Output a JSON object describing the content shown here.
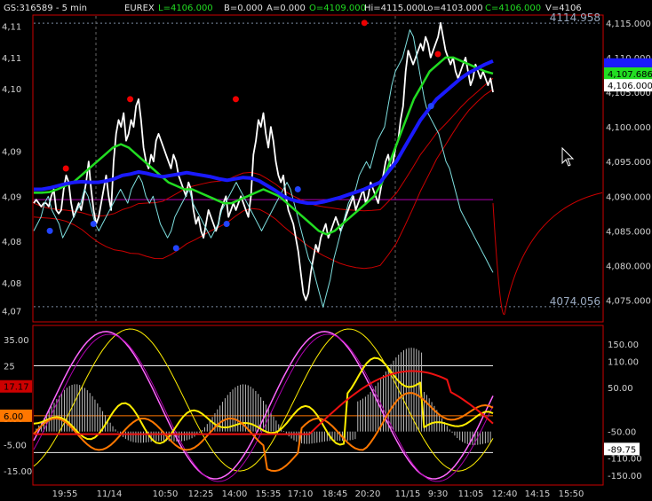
{
  "header": {
    "symbol": "GS:316589 - 5 min",
    "exchange": "EUREX",
    "last": "L=4106.000",
    "bid": "B=0.000",
    "ask": "A=0.000",
    "open": "O=4109.000",
    "high": "Hi=4115.000",
    "low": "Lo=4103.000",
    "close": "C=4106.000",
    "volume": "V=4106"
  },
  "colors": {
    "bg": "#000000",
    "price": "#ffffff",
    "cyan": "#7fe0e0",
    "green": "#22dd22",
    "blue": "#1a1aff",
    "red": "#cc0000",
    "magenta": "#b000b0",
    "yellow": "#ffee00",
    "orange": "#ff7700",
    "pink": "#ff66ff",
    "dot_red": "#ee0000",
    "dot_blue": "#2244ff",
    "gray_hist": "#bbbbbb"
  },
  "chart_data": [
    {
      "type": "line",
      "panel": "price",
      "title": "GS:316589 - 5 min",
      "ylim": [
        4072,
        4116
      ],
      "left_ticks": [
        "4,11",
        "4,11",
        "4,10",
        "4,09",
        "4,09",
        "4,08",
        "4,08",
        "4,07"
      ],
      "left_tick_values": [
        4114.5,
        4110,
        4105.5,
        4096.5,
        4090,
        4083.5,
        4077.5,
        4073.5
      ],
      "right_ticks": [
        4115,
        4110,
        4105,
        4100,
        4095,
        4090,
        4085,
        4080,
        4075
      ],
      "right_tick_labels": [
        "4,115.000",
        "4,110.000",
        "4,105.000",
        "4,100.000",
        "4,095.000",
        "4,090.000",
        "4,085.000",
        "4,080.000",
        "4,075.000"
      ],
      "upper_band_label": "4114.958",
      "upper_band_value": 4114.958,
      "lower_band_label": "4074.056",
      "lower_band_value": 4074.056,
      "horizontal_line": 4089.5,
      "price_badges": [
        {
          "label": "4,107.686",
          "value": 4107.686,
          "color": "#22dd22"
        },
        {
          "label": "4,106.000",
          "value": 4106.0,
          "color": "#ffffff"
        }
      ],
      "blue_badge_value": 4109.0,
      "x_ticks": [
        "19:55",
        "11/14",
        "10:50",
        "12:25",
        "14:00",
        "15:35",
        "17:10",
        "18:45",
        "20:20",
        "11/15",
        "9:30",
        "11:05",
        "12:40",
        "14:15",
        "15:50"
      ],
      "series": [
        {
          "role": "price",
          "color": "#ffffff",
          "values": [
            4089,
            4089.5,
            4089,
            4088.5,
            4089,
            4089,
            4088.5,
            4090,
            4091,
            4088,
            4087.5,
            4088,
            4091,
            4093,
            4092,
            4089,
            4087,
            4088,
            4089,
            4088,
            4090,
            4092,
            4095,
            4091,
            4088,
            4086,
            4087,
            4089,
            4091,
            4093,
            4090,
            4088,
            4095,
            4099,
            4101,
            4100,
            4102,
            4098,
            4099,
            4101,
            4100,
            4103,
            4104,
            4101,
            4097,
            4095,
            4094,
            4096,
            4095,
            4098,
            4099,
            4098,
            4097,
            4096,
            4095,
            4094,
            4096,
            4095,
            4093,
            4092,
            4091,
            4090,
            4092,
            4091,
            4088,
            4086,
            4087,
            4085,
            4084,
            4086,
            4088,
            4087,
            4086,
            4085,
            4086,
            4088,
            4089,
            4090,
            4087,
            4088,
            4089,
            4088,
            4089,
            4090,
            4089,
            4088,
            4087,
            4090,
            4096,
            4098,
            4101,
            4100,
            4102,
            4099,
            4097,
            4100,
            4098,
            4095,
            4093,
            4092,
            4093,
            4090,
            4088,
            4087,
            4086,
            4084,
            4082,
            4079,
            4076,
            4075,
            4076,
            4079,
            4081,
            4083,
            4082,
            4084,
            4085,
            4086,
            4084,
            4085,
            4086,
            4087,
            4086,
            4085,
            4086,
            4087,
            4088,
            4089,
            4090,
            4088,
            4089,
            4090,
            4091,
            4089,
            4090,
            4092,
            4091,
            4090,
            4089,
            4091,
            4093,
            4095,
            4096,
            4094,
            4095,
            4097,
            4098,
            4101,
            4103,
            4108,
            4111,
            4110,
            4109,
            4110,
            4111,
            4112,
            4111,
            4113,
            4112,
            4110,
            4111,
            4112,
            4113,
            4115,
            4113,
            4111,
            4110,
            4109,
            4110,
            4108,
            4107,
            4108,
            4109,
            4110,
            4108,
            4106,
            4107,
            4109,
            4108,
            4107,
            4108,
            4107,
            4106,
            4107,
            4105
          ]
        },
        {
          "role": "cyan-oscillator-overlay",
          "color": "#7fe0e0",
          "values": [
            4085,
            4086,
            4087,
            4089,
            4090,
            4088,
            4087,
            4086,
            4084,
            4085,
            4086,
            4087,
            4088,
            4089,
            4091,
            4090,
            4088,
            4086,
            4085,
            4086,
            4087,
            4088,
            4089,
            4090,
            4091,
            4090,
            4089,
            4091,
            4092,
            4093,
            4092,
            4090,
            4089,
            4090,
            4088,
            4086,
            4085,
            4084,
            4085,
            4087,
            4088,
            4089,
            4090,
            4091,
            4089,
            4088,
            4087,
            4086,
            4085,
            4084,
            4085,
            4086,
            4088,
            4089,
            4090,
            4091,
            4092,
            4091,
            4090,
            4089,
            4088,
            4087,
            4086,
            4085,
            4086,
            4087,
            4088,
            4089,
            4090,
            4091,
            4092,
            4091,
            4089,
            4087,
            4085,
            4083,
            4081,
            4080,
            4078,
            4076,
            4074,
            4076,
            4078,
            4081,
            4083,
            4085,
            4087,
            4089,
            4090,
            4091,
            4093,
            4094,
            4095,
            4094,
            4096,
            4098,
            4099,
            4100,
            4103,
            4106,
            4108,
            4109,
            4110,
            4112,
            4114,
            4113,
            4110,
            4107,
            4104,
            4102,
            4101,
            4100,
            4099,
            4097,
            4095,
            4094,
            4092,
            4090,
            4088,
            4087,
            4086,
            4085,
            4084,
            4083,
            4082,
            4081,
            4080,
            4079
          ]
        },
        {
          "role": "green-average",
          "color": "#22dd22",
          "values": [
            4090.5,
            4090.5,
            4090.6,
            4091,
            4091.5,
            4092,
            4093,
            4094,
            4095,
            4096,
            4097,
            4097.5,
            4097,
            4096,
            4095,
            4094,
            4093,
            4092,
            4091.5,
            4091,
            4091,
            4090.5,
            4090,
            4089.5,
            4089,
            4089,
            4089.5,
            4090,
            4090.5,
            4091,
            4090.5,
            4090,
            4089,
            4088,
            4087,
            4086,
            4085,
            4084.5,
            4085,
            4086,
            4087,
            4088,
            4089,
            4090,
            4092,
            4095,
            4098,
            4101,
            4104,
            4106,
            4108,
            4109,
            4110,
            4110,
            4109.5,
            4109,
            4108.5,
            4108,
            4107.7
          ]
        },
        {
          "role": "blue-average",
          "color": "#1a1aff",
          "values": [
            4091,
            4091,
            4091.2,
            4091.5,
            4091.8,
            4092,
            4092.1,
            4092,
            4092,
            4092.2,
            4092.5,
            4093,
            4093.2,
            4093.5,
            4093.3,
            4093,
            4092.8,
            4093,
            4093.2,
            4093.4,
            4093.2,
            4093,
            4092.8,
            4092.5,
            4092.3,
            4092.5,
            4092.7,
            4092.6,
            4092.2,
            4091.5,
            4090.8,
            4090,
            4089.5,
            4089.2,
            4089,
            4089,
            4089.2,
            4089.5,
            4089.8,
            4090.2,
            4090.6,
            4091,
            4091.5,
            4092,
            4093.5,
            4095,
            4097,
            4099,
            4101,
            4102.5,
            4104,
            4105,
            4106,
            4107,
            4107.8,
            4108.4,
            4109,
            4109.5
          ]
        }
      ],
      "dots": [
        {
          "i": 0.07,
          "v": 4094,
          "color": "#ee0000"
        },
        {
          "i": 0.21,
          "v": 4104,
          "color": "#ee0000"
        },
        {
          "i": 0.44,
          "v": 4104,
          "color": "#ee0000"
        },
        {
          "i": 0.72,
          "v": 4115,
          "color": "#ee0000"
        },
        {
          "i": 0.88,
          "v": 4110.5,
          "color": "#ee0000"
        },
        {
          "i": 0.035,
          "v": 4085,
          "color": "#2244ff"
        },
        {
          "i": 0.13,
          "v": 4086,
          "color": "#2244ff"
        },
        {
          "i": 0.31,
          "v": 4082.5,
          "color": "#2244ff"
        },
        {
          "i": 0.42,
          "v": 4086,
          "color": "#2244ff"
        },
        {
          "i": 0.575,
          "v": 4091,
          "color": "#2244ff"
        },
        {
          "i": 0.865,
          "v": 4103,
          "color": "#2244ff"
        }
      ]
    },
    {
      "type": "line",
      "panel": "oscillator",
      "ylim": [
        -20,
        40
      ],
      "left_ticks": [
        "35.00",
        "25",
        "5.00",
        "-5.00",
        "-15.00"
      ],
      "left_tick_values": [
        35,
        25,
        5,
        -5,
        -15
      ],
      "right_ticks": [
        "150.00",
        "110.00",
        "50.00",
        "-50.00",
        "-110.00",
        "-150.00"
      ],
      "right_tick_values": [
        150,
        110,
        50,
        -50,
        -110,
        -150
      ],
      "badges": [
        {
          "label": "17.17",
          "side": "left",
          "color": "#cc0000",
          "value": 17.17
        },
        {
          "label": "6.00",
          "side": "left",
          "color": "#ff7700",
          "value": 6
        },
        {
          "label": "-89.75",
          "side": "right",
          "color": "#ffffff",
          "value": -89.75
        }
      ],
      "reference_lines": [
        25,
        6,
        -8
      ]
    }
  ]
}
